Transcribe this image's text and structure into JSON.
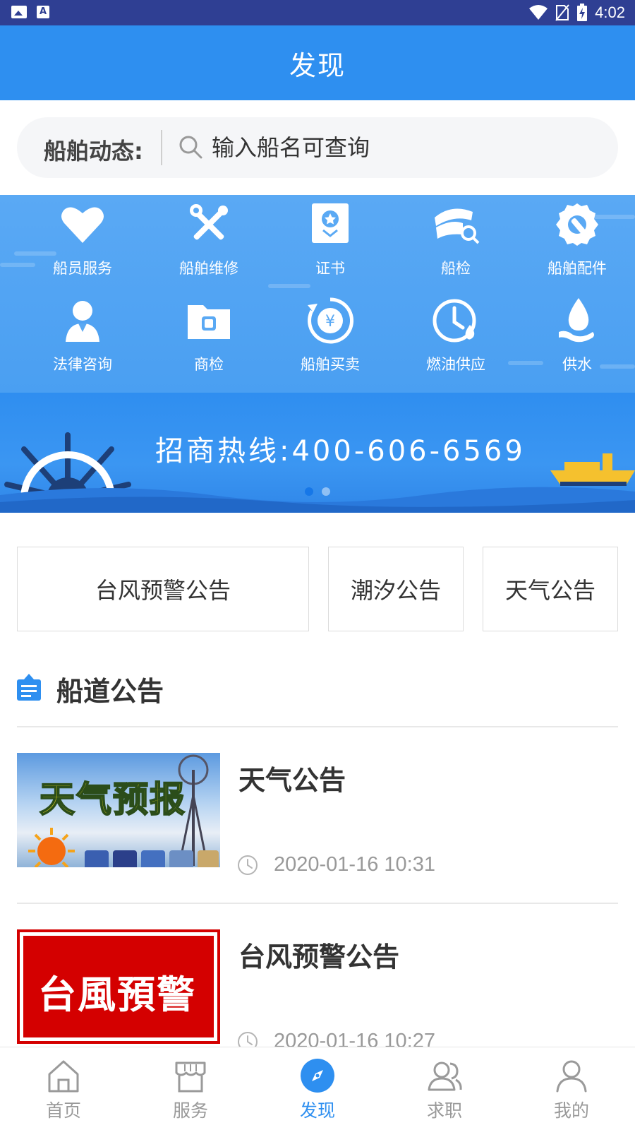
{
  "status_bar": {
    "time": "4:02"
  },
  "header": {
    "title": "发现"
  },
  "search": {
    "label": "船舶动态:",
    "placeholder": "输入船名可查询"
  },
  "services": [
    {
      "label": "船员服务",
      "icon": "heart-icon"
    },
    {
      "label": "船舶维修",
      "icon": "tools-icon"
    },
    {
      "label": "证书",
      "icon": "certificate-icon"
    },
    {
      "label": "船检",
      "icon": "ship-inspection-icon"
    },
    {
      "label": "船舶配件",
      "icon": "gear-wrench-icon"
    },
    {
      "label": "法律咨询",
      "icon": "lawyer-icon"
    },
    {
      "label": "商检",
      "icon": "folder-icon"
    },
    {
      "label": "船舶买卖",
      "icon": "yuan-cycle-icon"
    },
    {
      "label": "燃油供应",
      "icon": "fuel-clock-icon"
    },
    {
      "label": "供水",
      "icon": "water-drop-icon"
    }
  ],
  "banner": {
    "hotline": "招商热线:400-606-6569",
    "page_count": 2,
    "active_page": 1
  },
  "notice_buttons": [
    {
      "label": "台风预警公告"
    },
    {
      "label": "潮汐公告"
    },
    {
      "label": "天气公告"
    }
  ],
  "section": {
    "title": "船道公告"
  },
  "news": [
    {
      "title": "天气公告",
      "time": "2020-01-16 10:31",
      "thumb_text": "天气预报"
    },
    {
      "title": "台风预警公告",
      "time": "2020-01-16 10:27",
      "thumb_text": "台風預警"
    }
  ],
  "bottom_nav": [
    {
      "label": "首页",
      "icon": "home-icon"
    },
    {
      "label": "服务",
      "icon": "store-icon"
    },
    {
      "label": "发现",
      "icon": "compass-icon",
      "active": true
    },
    {
      "label": "求职",
      "icon": "users-icon"
    },
    {
      "label": "我的",
      "icon": "user-icon"
    }
  ],
  "colors": {
    "primary": "#2e8ff0",
    "status_bar": "#2f3f93",
    "services_bg": "#5aa9f4",
    "thumb_red": "#d40000"
  }
}
